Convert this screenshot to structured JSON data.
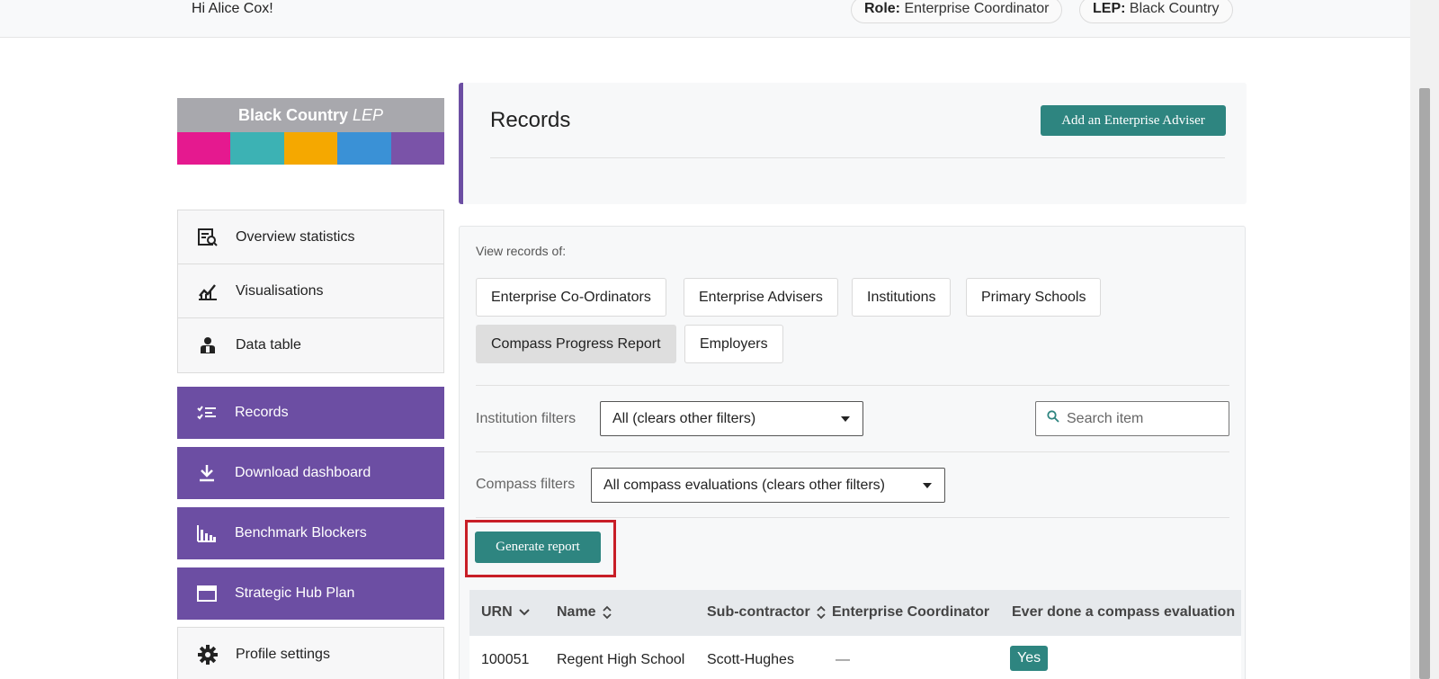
{
  "user": {
    "greeting": "Hi Alice Cox!",
    "role_label": "Role:",
    "role_value": "Enterprise Coordinator",
    "lep_label": "LEP:",
    "lep_value": "Black Country"
  },
  "logo": {
    "text_bold": "Black Country",
    "text_italic": "LEP",
    "bar_colors": [
      "#e5198f",
      "#3cb2b4",
      "#f5a800",
      "#3a91d6",
      "#7a53a8"
    ]
  },
  "sidebar": {
    "top_items": [
      {
        "label": "Overview statistics",
        "icon": "report-search-icon"
      },
      {
        "label": "Visualisations",
        "icon": "chart-trend-icon"
      },
      {
        "label": "Data table",
        "icon": "user-table-icon"
      }
    ],
    "purple_items": [
      {
        "label": "Records",
        "icon": "checklist-icon"
      },
      {
        "label": "Download dashboard",
        "icon": "download-icon"
      },
      {
        "label": "Benchmark Blockers",
        "icon": "bar-chart-icon"
      },
      {
        "label": "Strategic Hub Plan",
        "icon": "window-icon"
      }
    ],
    "bottom_items": [
      {
        "label": "Profile settings",
        "icon": "gear-icon"
      }
    ]
  },
  "records": {
    "title": "Records",
    "add_button": "Add an Enterprise Adviser"
  },
  "view": {
    "label": "View records of:",
    "tabs": [
      {
        "label": "Enterprise Co-Ordinators",
        "active": false
      },
      {
        "label": "Enterprise Advisers",
        "active": false
      },
      {
        "label": "Institutions",
        "active": false
      },
      {
        "label": "Primary Schools",
        "active": false
      },
      {
        "label": "Compass Progress Report",
        "active": true
      },
      {
        "label": "Employers",
        "active": false
      }
    ]
  },
  "filters": {
    "institution_label": "Institution filters",
    "institution_value": "All (clears other filters)",
    "compass_label": "Compass filters",
    "compass_value": "All compass evaluations (clears other filters)",
    "search_placeholder": "Search item"
  },
  "generate_button": "Generate report",
  "table": {
    "columns": [
      "URN",
      "Name",
      "Sub-contractor",
      "Enterprise Coordinator",
      "Ever done a compass evaluation"
    ],
    "rows": [
      {
        "urn": "100051",
        "name": "Regent High School",
        "subcontractor": "Scott-Hughes",
        "coordinator": "—",
        "evaluation": "Yes"
      }
    ]
  },
  "colors": {
    "accent_purple": "#6c4ea3",
    "teal": "#2e8580",
    "highlight_red": "#c81e27"
  }
}
